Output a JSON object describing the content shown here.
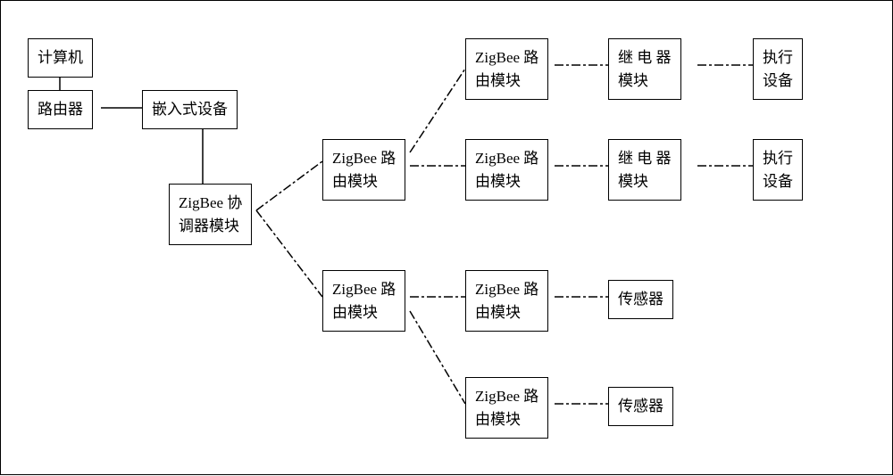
{
  "nodes": {
    "computer": "计算机",
    "router": "路由器",
    "embedded": "嵌入式设备",
    "coordinator_l1": "ZigBee 协",
    "coordinator_l2": "调器模块",
    "zigbee_route_l1": "ZigBee 路",
    "zigbee_route_l2": "由模块",
    "relay_l1": "继 电 器",
    "relay_l2": "模块",
    "exec_l1": "执行",
    "exec_l2": "设备",
    "sensor": "传感器"
  }
}
